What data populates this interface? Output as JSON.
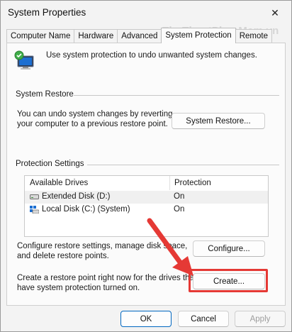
{
  "window": {
    "title": "System Properties",
    "close_glyph": "✕",
    "watermark": "ThuThuatPhanMem.vn"
  },
  "tabs": [
    {
      "label": "Computer Name",
      "active": false
    },
    {
      "label": "Hardware",
      "active": false
    },
    {
      "label": "Advanced",
      "active": false
    },
    {
      "label": "System Protection",
      "active": true
    },
    {
      "label": "Remote",
      "active": false
    }
  ],
  "intro": {
    "icon": "system-protection-icon",
    "text": "Use system protection to undo unwanted system changes."
  },
  "system_restore": {
    "group_label": "System Restore",
    "desc_line1": "You can undo system changes by reverting",
    "desc_line2": "your computer to a previous restore point.",
    "button_label": "System Restore..."
  },
  "protection_settings": {
    "group_label": "Protection Settings",
    "columns": [
      "Available Drives",
      "Protection"
    ],
    "drives": [
      {
        "name": "Extended Disk (D:)",
        "protection": "On",
        "icon": "drive-icon",
        "selected": true
      },
      {
        "name": "Local Disk (C:) (System)",
        "protection": "On",
        "icon": "system-drive-icon",
        "selected": false
      }
    ],
    "configure_desc_line1": "Configure restore settings, manage disk space,",
    "configure_desc_line2": "and delete restore points.",
    "configure_label": "Configure...",
    "create_desc_line1": "Create a restore point right now for the drives that",
    "create_desc_line2": "have system protection turned on.",
    "create_label": "Create..."
  },
  "footer": {
    "ok_label": "OK",
    "cancel_label": "Cancel",
    "apply_label": "Apply"
  },
  "colors": {
    "accent": "#0067c0",
    "highlight": "#e53935"
  }
}
